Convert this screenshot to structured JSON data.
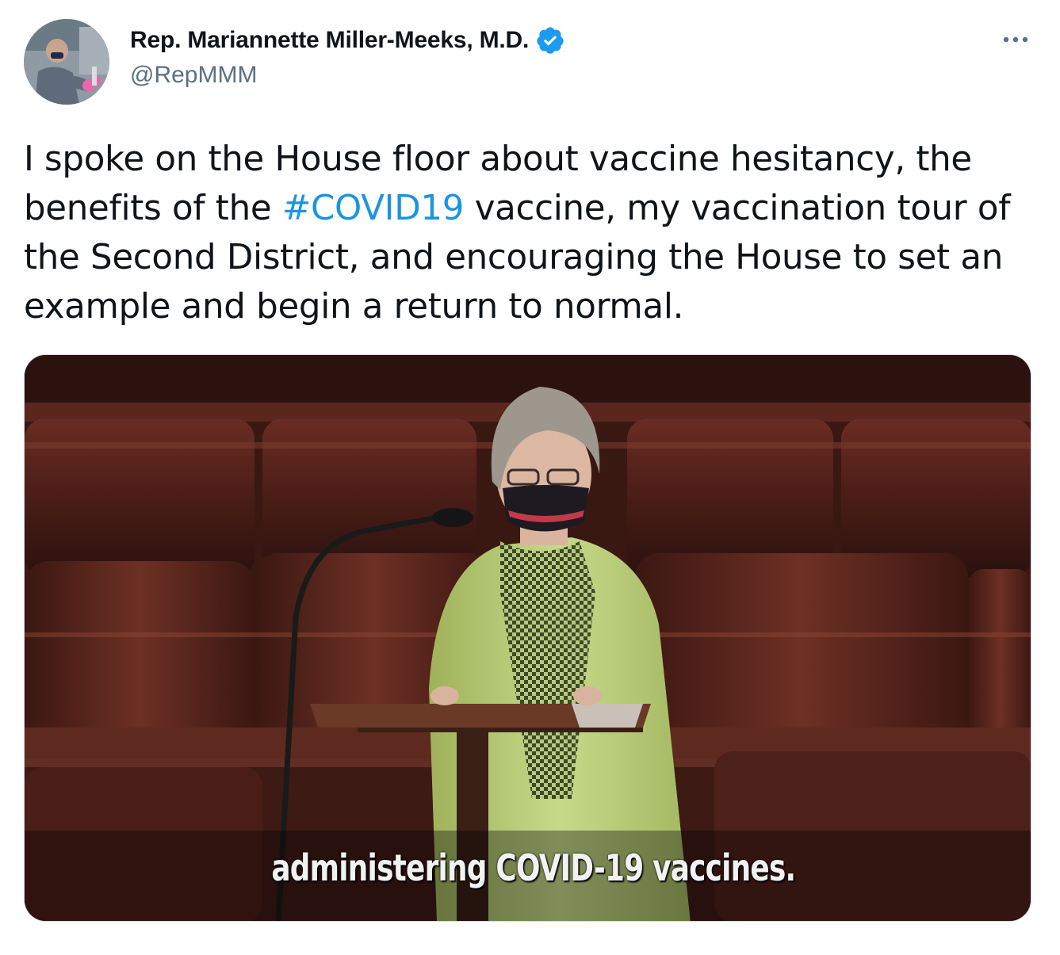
{
  "author": {
    "display_name": "Rep. Mariannette Miller-Meeks, M.D.",
    "handle": "@RepMMM",
    "verified": true,
    "verified_color": "#1d9bf0"
  },
  "tweet": {
    "text_before_hashtag": "I spoke on the House floor about vaccine hesitancy, the benefits of the ",
    "hashtag": "#COVID19",
    "text_after_hashtag": " vaccine, my vaccination tour of the Second District, and encouraging the House to set an example and begin a return to normal.",
    "hashtag_color": "#1b95e0"
  },
  "media": {
    "type": "video",
    "caption": "administering COVID-19 vaccines."
  },
  "icons": {
    "more": "more-horizontal-icon",
    "verified": "verified-badge-icon"
  }
}
